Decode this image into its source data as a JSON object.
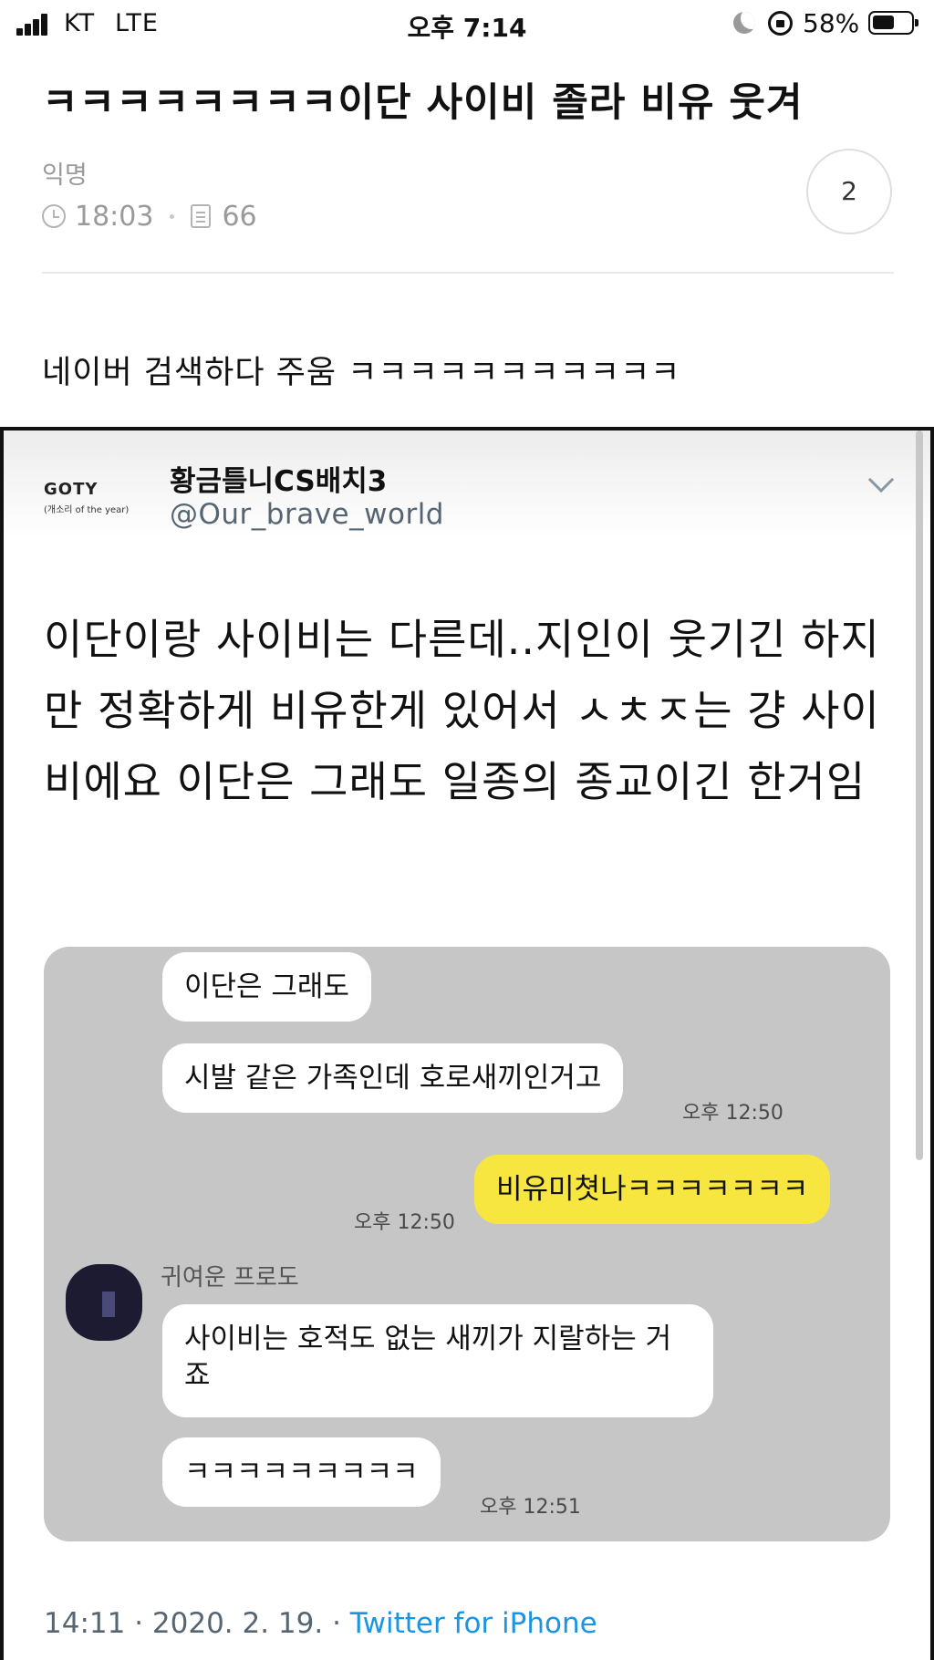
{
  "status_bar": {
    "carrier": "KT",
    "network": "LTE",
    "time": "오후 7:14",
    "battery_percent": "58%",
    "battery_level": 0.58,
    "icons": [
      "signal-icon",
      "moon-icon",
      "lock-rotation-icon",
      "battery-icon"
    ]
  },
  "post": {
    "title": "ㅋㅋㅋㅋㅋㅋㅋㅋ이단 사이비 졸라 비유 웃겨",
    "author": "익명",
    "time": "18:03",
    "views": "66",
    "comment_count": "2",
    "body_text": "네이버 검색하다 주움 ㅋㅋㅋㅋㅋㅋㅋㅋㅋㅋㅋ"
  },
  "tweet": {
    "logo_text": "GOTY",
    "logo_subtext": "(개소리 of the year)",
    "display_name": "황금틀니CS배치3",
    "handle": "@Our_brave_world",
    "text": "이단이랑 사이비는 다른데..지인이 웃기긴 하지만 정확하게 비유한게 있어서 ㅅㅊㅈ는 걍 사이비에요 이단은 그래도 일종의 종교이긴 한거임",
    "footer_datetime": "14:11 · 2020. 2. 19. · ",
    "footer_source": "Twitter for iPhone"
  },
  "chat": {
    "messages": [
      {
        "text": "이단은 그래도"
      },
      {
        "text": "시발 같은 가족인데 호로새끼인거고",
        "time": "오후 12:50"
      },
      {
        "text": "비유미쳣나ㅋㅋㅋㅋㅋㅋㅋ",
        "time": "오후 12:50"
      },
      {
        "sender": "귀여운 프로도"
      },
      {
        "text": "사이비는 호적도 없는 새끼가 지랄하는 거죠"
      },
      {
        "text": "ㅋㅋㅋㅋㅋㅋㅋㅋㅋ",
        "time": "오후 12:51"
      }
    ]
  },
  "colors": {
    "accent": "#1b95e0",
    "chat_background": "#c6c6c6",
    "my_bubble": "#f7e640",
    "meta_gray": "#9a9a9a"
  }
}
